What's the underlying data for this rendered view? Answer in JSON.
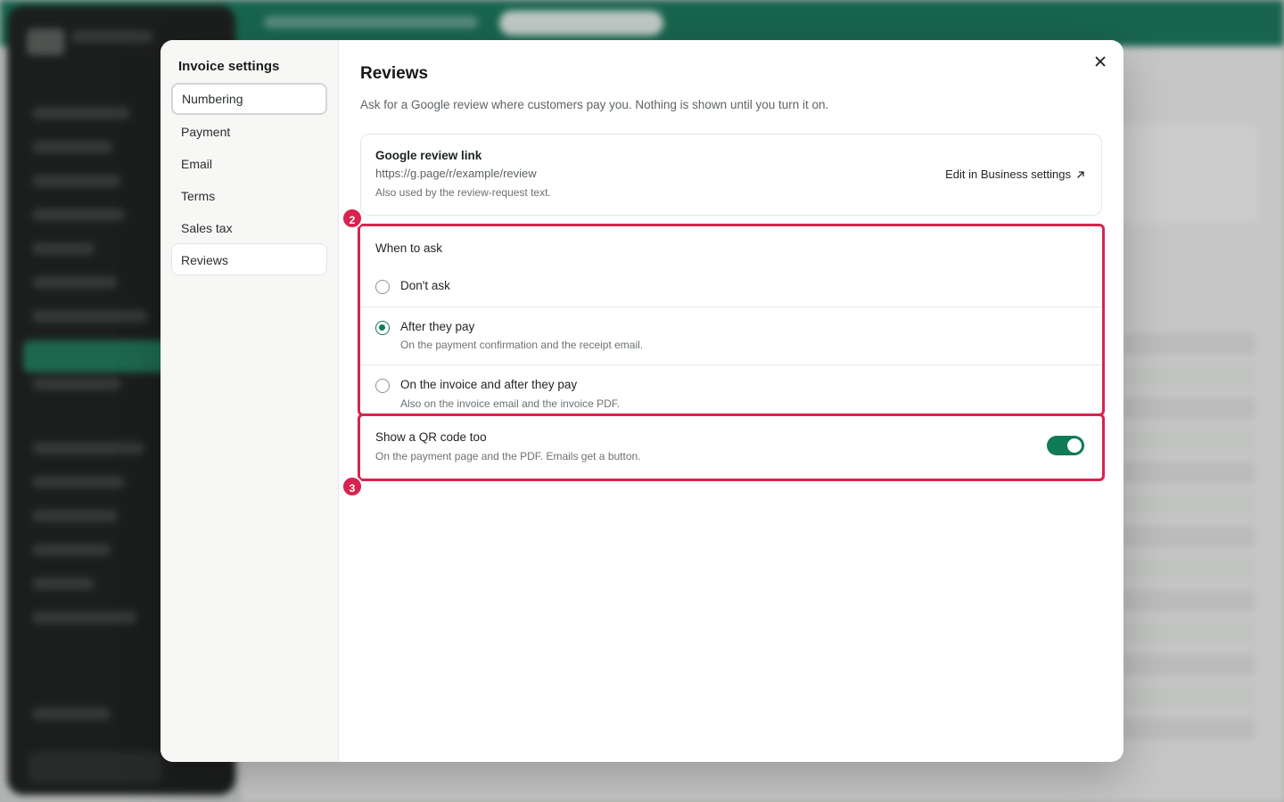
{
  "modal": {
    "nav_title": "Invoice settings",
    "nav_items": [
      {
        "label": "Numbering"
      },
      {
        "label": "Payment"
      },
      {
        "label": "Email"
      },
      {
        "label": "Terms"
      },
      {
        "label": "Sales tax"
      },
      {
        "label": "Reviews"
      }
    ],
    "title": "Reviews",
    "subtitle": "Ask for a Google review where customers pay you. Nothing is shown until you turn it on.",
    "review_link": {
      "label": "Google review link",
      "url": "https://g.page/r/example/review",
      "note": "Also used by the review-request text.",
      "edit_label": "Edit in Business settings"
    },
    "when_to_ask": {
      "heading": "When to ask",
      "selected": "after_pay",
      "options": [
        {
          "id": "dont_ask",
          "label": "Don't ask",
          "description": ""
        },
        {
          "id": "after_pay",
          "label": "After they pay",
          "description": "On the payment confirmation and the receipt email."
        },
        {
          "id": "invoice_and_after",
          "label": "On the invoice and after they pay",
          "description": "Also on the invoice email and the invoice PDF."
        }
      ]
    },
    "qr": {
      "label": "Show a QR code too",
      "description": "On the payment page and the PDF. Emails get a button.",
      "enabled": true
    }
  },
  "annotations": [
    {
      "number": "2"
    },
    {
      "number": "3"
    }
  ],
  "colors": {
    "accent": "#127a58",
    "highlight": "#d8234f",
    "banner": "#15775a"
  },
  "icons": {
    "close": "close-icon",
    "external": "external-link-icon"
  }
}
